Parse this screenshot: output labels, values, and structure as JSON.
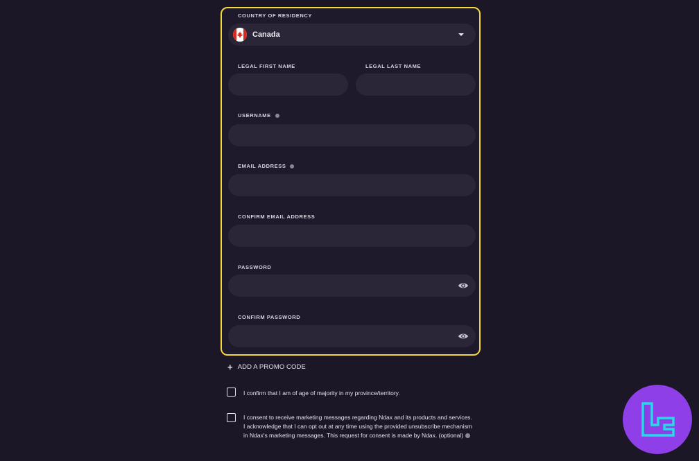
{
  "form": {
    "country": {
      "label": "COUNTRY OF RESIDENCY",
      "value": "Canada",
      "flag_icon": "canada-flag-icon"
    },
    "first_name": {
      "label": "LEGAL FIRST NAME",
      "value": ""
    },
    "last_name": {
      "label": "LEGAL LAST NAME",
      "value": ""
    },
    "username": {
      "label": "USERNAME",
      "value": ""
    },
    "email": {
      "label": "EMAIL ADDRESS",
      "value": ""
    },
    "confirm_email": {
      "label": "CONFIRM EMAIL ADDRESS",
      "value": ""
    },
    "password": {
      "label": "PASSWORD",
      "value": ""
    },
    "confirm_password": {
      "label": "CONFIRM PASSWORD",
      "value": ""
    }
  },
  "promo": {
    "label": "ADD A PROMO CODE"
  },
  "checkboxes": [
    {
      "text": "I confirm that I am of age of majority in my province/territory.",
      "checked": false
    },
    {
      "text": "I consent to receive marketing messages regarding Ndax and its products and services. I acknowledge that I can opt out at any time using the provided unsubscribe mechanism in Ndax's marketing messages. This request for consent is made by Ndax. (optional)",
      "checked": false
    }
  ],
  "colors": {
    "background": "#1b1727",
    "panel": "#1e1a2c",
    "highlight_border": "#f4d93a",
    "input": "#2a2638",
    "brand_badge": "#8f3fe8",
    "brand_mark": "#27d8e8"
  }
}
